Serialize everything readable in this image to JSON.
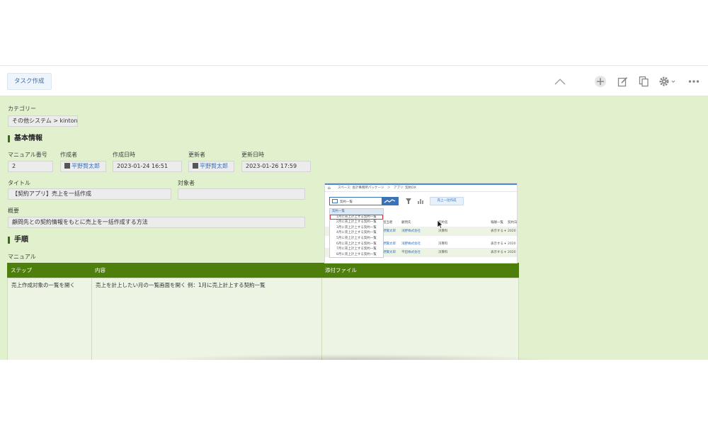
{
  "toolbar": {
    "task_button": "タスク作成",
    "icons": [
      "chevron-up-icon",
      "plus-icon",
      "edit-icon",
      "copy-icon",
      "gear-icon",
      "more-icon"
    ]
  },
  "category": {
    "label": "カテゴリー",
    "value": "その他システム > kintone"
  },
  "basic": {
    "title": "基本情報",
    "manual_no_label": "マニュアル番号",
    "manual_no": "2",
    "creator_label": "作成者",
    "creator": "平野賢太郎",
    "created_label": "作成日時",
    "created": "2023-01-24 16:51",
    "updater_label": "更新者",
    "updater": "平野賢太郎",
    "updated_label": "更新日時",
    "updated": "2023-01-26 17:59",
    "title_label": "タイトル",
    "title_value": "【契約アプリ】売上を一括作成",
    "target_label": "対象者",
    "target_value": "",
    "summary_label": "概要",
    "summary_value": "顧問先との契約情報をもとに売上を一括作成する方法"
  },
  "steps": {
    "title": "手順",
    "manual_label": "マニュアル",
    "col_step": "ステップ",
    "col_content": "内容",
    "col_attach": "添付ファイル",
    "rows": [
      {
        "step": "売上作成対象の一覧を開く",
        "content": "売上を計上したい月の一覧画面を開く 例：1月に売上計上する契約一覧"
      }
    ]
  },
  "attachment": {
    "breadcrumb": "スペース: 会計事務所パッケージ　＞　アプリ: 契約DX",
    "view_select": "契約一覧",
    "create_button": "売上一括作成",
    "dropdown": [
      "契約一覧",
      "1月に売上計上する契約一覧",
      "2月に売上計上する契約一覧",
      "3月に売上計上する契約一覧",
      "4月に売上計上する契約一覧",
      "5月に売上計上する契約一覧",
      "6月に売上計上する契約一覧",
      "7月に売上計上する契約一覧",
      "8月に売上計上する契約一覧"
    ],
    "headers": [
      "担当者",
      "顧問先",
      "契約名",
      "報酬一覧",
      "契約日"
    ],
    "rows": [
      [
        "野賢太郎",
        "浅野株式会社",
        "決算料",
        "表示する ▾",
        "2020"
      ],
      [
        "野賢太郎",
        "浅野株式会社",
        "決算料",
        "表示する ▾",
        "2020"
      ],
      [
        "野賢太郎",
        "平田株式会社",
        "決算料",
        "表示する ▾",
        "2020"
      ]
    ]
  }
}
